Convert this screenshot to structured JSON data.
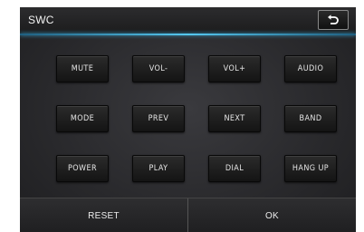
{
  "header": {
    "title": "SWC",
    "back_icon": "return-arrow-icon"
  },
  "buttons": [
    [
      "MUTE",
      "VOL-",
      "VOL+",
      "AUDIO"
    ],
    [
      "MODE",
      "PREV",
      "NEXT",
      "BAND"
    ],
    [
      "POWER",
      "PLAY",
      "DIAL",
      "HANG UP"
    ]
  ],
  "footer": {
    "reset_label": "RESET",
    "ok_label": "OK"
  },
  "colors": {
    "accent": "#55c8f0",
    "panel": "#2a2a2d",
    "button": "#1c1c1c"
  }
}
